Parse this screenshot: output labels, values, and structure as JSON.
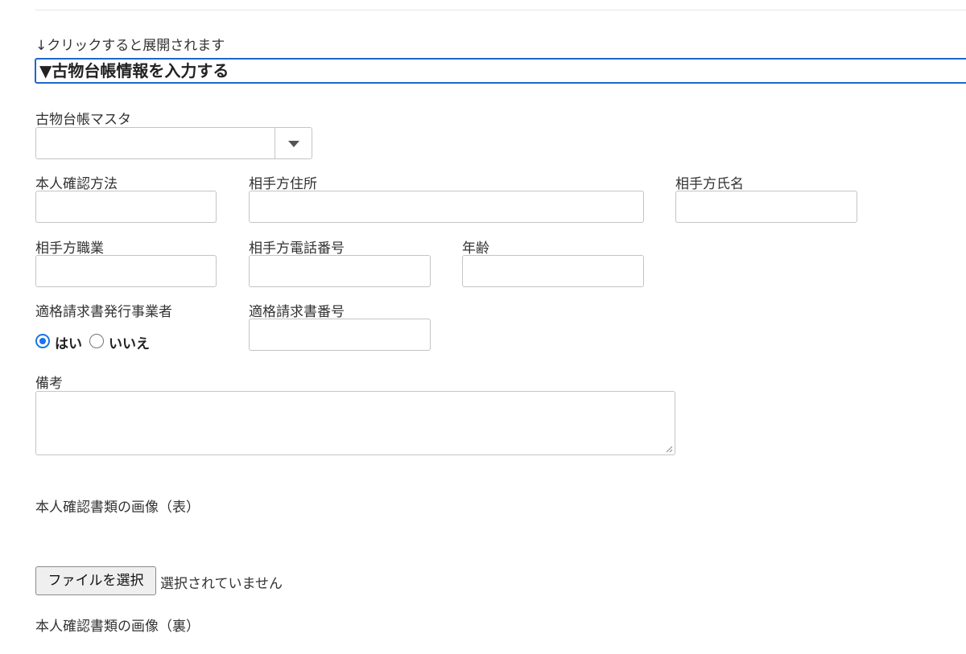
{
  "hint": "↓クリックすると展開されます",
  "section": {
    "toggle_label": "▼古物台帳情報を入力する"
  },
  "fields": {
    "ledger_master": {
      "label": "古物台帳マスタ",
      "value": ""
    },
    "id_method": {
      "label": "本人確認方法",
      "value": ""
    },
    "address": {
      "label": "相手方住所",
      "value": ""
    },
    "name": {
      "label": "相手方氏名",
      "value": ""
    },
    "occupation": {
      "label": "相手方職業",
      "value": ""
    },
    "phone": {
      "label": "相手方電話番号",
      "value": ""
    },
    "age": {
      "label": "年齢",
      "value": ""
    },
    "qualified_issuer": {
      "label": "適格請求書発行事業者",
      "options": [
        "はい",
        "いいえ"
      ],
      "selected": "はい"
    },
    "invoice_number": {
      "label": "適格請求書番号",
      "value": ""
    },
    "notes": {
      "label": "備考",
      "value": ""
    }
  },
  "uploads": {
    "front": {
      "label": "本人確認書類の画像（表）",
      "button_label": "ファイルを選択",
      "status": "選択されていません"
    },
    "back": {
      "label": "本人確認書類の画像（裏）"
    }
  },
  "colors": {
    "accent": "#1f67c8",
    "radio": "#1a73e8",
    "border": "#c4c4c4"
  }
}
